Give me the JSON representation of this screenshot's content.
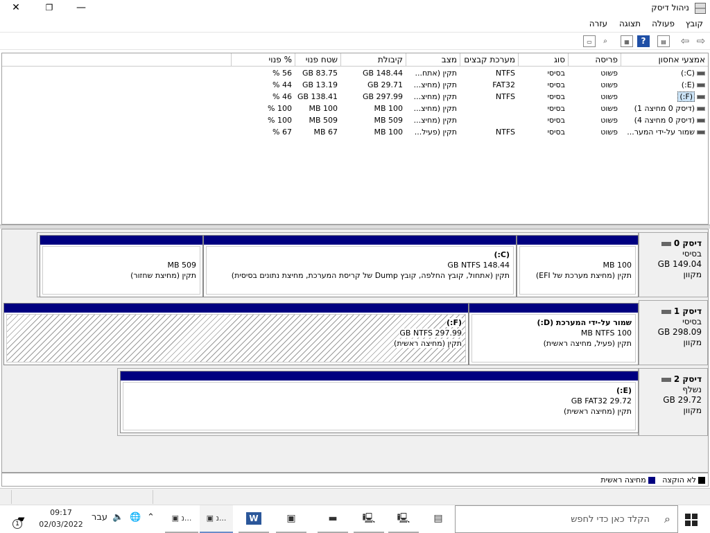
{
  "window": {
    "title": "ניהול דיסק",
    "minimize_glyph": "—",
    "maximize_glyph": "❐",
    "close_glyph": "✕"
  },
  "menu": {
    "items": [
      "קובץ",
      "פעולה",
      "תצוגה",
      "עזרה"
    ]
  },
  "toolbar": {
    "back_glyph": "⇦",
    "forward_glyph": "⇨",
    "help_glyph": "?",
    "icons": [
      "back-icon",
      "forward-icon",
      "properties-icon",
      "help-icon",
      "refresh-icon",
      "connect-icon",
      "view-icon"
    ]
  },
  "volumes": {
    "headers": [
      "אמצעי אחסון",
      "פריסה",
      "סוג",
      "מערכת קבצים",
      "מצב",
      "קיבולת",
      "שטח פנוי",
      "% פנוי"
    ],
    "rows": [
      [
        "(C:)",
        "פשוט",
        "בסיסי",
        "NTFS",
        "תקין (אתח...",
        "GB 148.44",
        "GB 83.75",
        "% 56"
      ],
      [
        "(E:)",
        "פשוט",
        "בסיסי",
        "FAT32",
        "תקין (מחיצ...",
        "GB 29.71",
        "GB 13.19",
        "% 44"
      ],
      [
        "(F:)",
        "פשוט",
        "בסיסי",
        "NTFS",
        "תקין (מחיצ...",
        "GB 297.99",
        "GB 138.41",
        "% 46"
      ],
      [
        "(דיסק 0 מחיצה 1)",
        "פשוט",
        "בסיסי",
        "",
        "תקין (מחיצ...",
        "MB 100",
        "MB 100",
        "% 100"
      ],
      [
        "(דיסק 0 מחיצה 4)",
        "פשוט",
        "בסיסי",
        "",
        "תקין (מחיצ...",
        "MB 509",
        "MB 509",
        "% 100"
      ],
      [
        "שמור על-ידי המער...",
        "פשוט",
        "בסיסי",
        "NTFS",
        "תקין (פעיל...",
        "MB 100",
        "MB 67",
        "% 67"
      ]
    ]
  },
  "disks": [
    {
      "name": "דיסק 0",
      "type": "בסיסי",
      "size": "GB 149.04",
      "status": "מקוון",
      "partitions": [
        {
          "title": "",
          "size": "MB 100",
          "desc": "תקין (מחיצת מערכת של EFI)"
        },
        {
          "title": "(C:)",
          "size": "GB NTFS 148.44",
          "desc": "תקין (אתחול, קובץ החלפה, קובץ Dump של קריסת המערכת, מחיצת נתונים בסיסית)"
        },
        {
          "title": "",
          "size": "MB 509",
          "desc": "תקין (מחיצת שחזור)"
        }
      ]
    },
    {
      "name": "דיסק 1",
      "type": "בסיסי",
      "size": "GB 298.09",
      "status": "מקוון",
      "partitions": [
        {
          "title": "שמור על-ידי המערכת  (D:)",
          "size": "MB NTFS 100",
          "desc": "תקין (פעיל, מחיצה ראשית)"
        },
        {
          "title": "(F:)",
          "size": "GB NTFS 297.99",
          "desc": "תקין (מחיצה ראשית)"
        }
      ]
    },
    {
      "name": "דיסק 2",
      "type": "נשלף",
      "size": "GB 29.72",
      "status": "מקוון",
      "partitions": [
        {
          "title": "(E:)",
          "size": "GB FAT32 29.72",
          "desc": "תקין (מחיצה ראשית)"
        }
      ]
    }
  ],
  "legend": {
    "unallocated": "לא הוקצה",
    "primary": "מחיצה ראשית",
    "unallocated_color": "#000000",
    "primary_color": "#000080"
  },
  "taskbar": {
    "search_placeholder": "הקלד כאן כדי לחפש",
    "language": "עבר",
    "time": "09:17",
    "date": "02/03/2022",
    "notification_count": "1",
    "app_labels": [
      "נ...",
      "נ..."
    ],
    "word_letter": "W"
  }
}
